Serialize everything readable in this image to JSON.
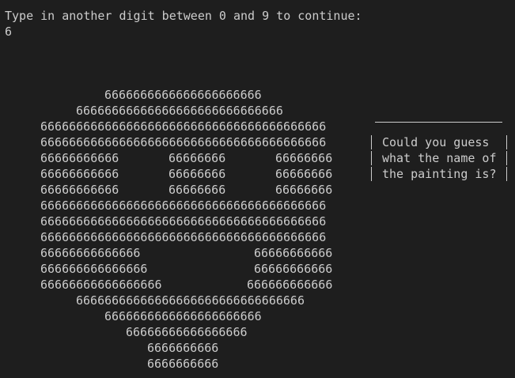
{
  "terminal": {
    "prompt": "Type in another digit between 0 and 9 to continue:",
    "input": "6",
    "art": [
      "6666666666666666666666",
      "66666666666666666666666666666",
      "6666666666666666666666666666666666666666",
      "6666666666666666666666666666666666666666",
      "66666666666",
      "66666666",
      "66666666",
      "66666666666",
      "66666666",
      "66666666",
      "66666666666",
      "66666666",
      "66666666",
      "6666666666666666666666666666666666666666",
      "6666666666666666666666666666666666666666",
      "6666666666666666666666666666666666666666",
      "66666666666666",
      "66666666666",
      "666666666666666",
      "66666666666",
      "66666666666666666",
      "666666666666",
      "66666666666666666666666666666666",
      "6666666666666666666666",
      "66666666666666666",
      "6666666666",
      "6666666666"
    ],
    "caption": [
      "Could you guess",
      "what the name of",
      "the painting is?"
    ]
  }
}
